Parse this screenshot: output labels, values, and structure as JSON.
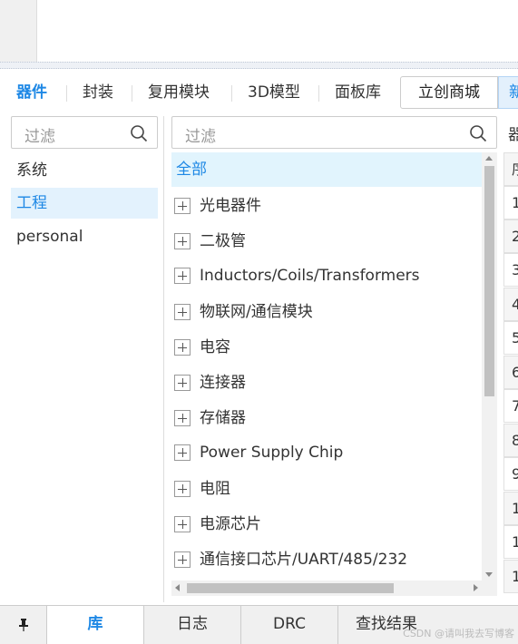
{
  "tabs": [
    {
      "label": "器件",
      "active": true
    },
    {
      "label": "封装",
      "active": false
    },
    {
      "label": "复用模块",
      "active": false
    },
    {
      "label": "3D模型",
      "active": false
    },
    {
      "label": "面板库",
      "active": false
    }
  ],
  "shop_button": "立创商城",
  "new_button": "新",
  "left_filter_placeholder": "过滤",
  "tree_filter_placeholder": "过滤",
  "libraries": [
    {
      "label": "系统",
      "active": false
    },
    {
      "label": "工程",
      "active": true
    },
    {
      "label": "personal",
      "active": false
    }
  ],
  "tree": {
    "root": "全部",
    "items": [
      "光电器件",
      "二极管",
      "Inductors/Coils/Transformers",
      "物联网/通信模块",
      "电容",
      "连接器",
      "存储器",
      "Power Supply Chip",
      "电阻",
      "电源芯片",
      "通信接口芯片/UART/485/232"
    ]
  },
  "right_panel": {
    "header": "器",
    "row_header": "序",
    "rows": [
      "1",
      "2",
      "3",
      "4",
      "5",
      "6",
      "7",
      "8",
      "9",
      "1",
      "1",
      "1"
    ]
  },
  "bottom_tabs": [
    {
      "label": "库",
      "active": true
    },
    {
      "label": "日志",
      "active": false
    },
    {
      "label": "DRC",
      "active": false
    },
    {
      "label": "查找结果",
      "active": false
    }
  ],
  "watermark": "CSDN @请叫我去写博客",
  "colors": {
    "accent": "#1e88e5",
    "selected_bg": "#e3f2fd"
  }
}
